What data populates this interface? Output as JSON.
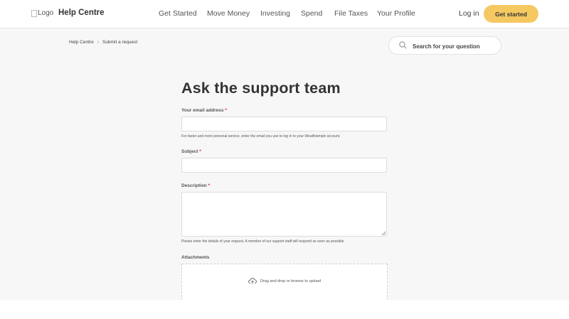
{
  "header": {
    "logo_alt": "Logo",
    "brand": "Help Centre",
    "nav": [
      "Get Started",
      "Move Money",
      "Investing",
      "Spend",
      "File Taxes",
      "Your Profile"
    ],
    "login": "Log in",
    "cta": "Get started"
  },
  "breadcrumb": {
    "items": [
      "Help Centre",
      "Submit a request"
    ]
  },
  "search": {
    "placeholder": "Search for your question",
    "icon": "search-icon"
  },
  "form": {
    "title": "Ask the support team",
    "email": {
      "label": "Your email address",
      "required_mark": "*",
      "value": "",
      "hint": "For faster and more personal service, enter the email you use to log in to your Wealthsimple account."
    },
    "subject": {
      "label": "Subject",
      "required_mark": "*",
      "value": ""
    },
    "description": {
      "label": "Description",
      "required_mark": "*",
      "value": "",
      "hint": "Please enter the details of your request. A member of our support staff will respond as soon as possible."
    },
    "attachments": {
      "label": "Attachments",
      "drop_text": "Drag and drop or browse to upload",
      "icon": "cloud-upload-icon"
    }
  },
  "colors": {
    "accent": "#f5c862",
    "required": "#e0261a",
    "background": "#f7f7f7"
  }
}
